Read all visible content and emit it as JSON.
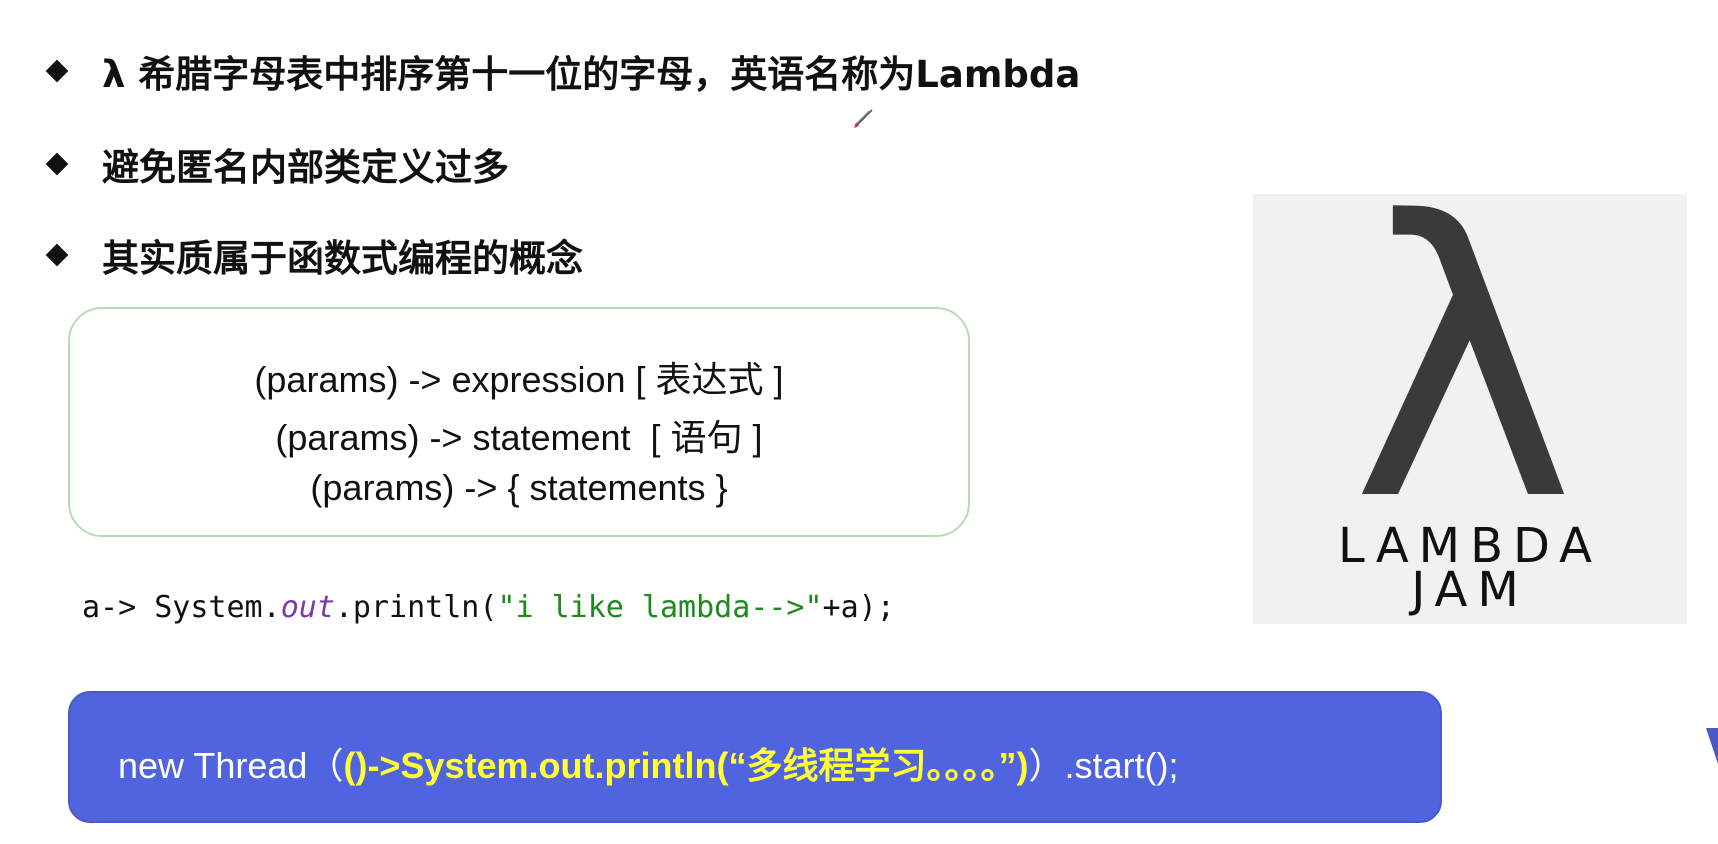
{
  "bullets": [
    "λ 希腊字母表中排序第十一位的字母，英语名称为Lambda",
    "避免匿名内部类定义过多",
    "其实质属于函数式编程的概念"
  ],
  "syntax_forms": [
    "(params) -> expression [ 表达式 ]",
    "(params) -> statement  [ 语句 ]",
    "(params) -> { statements }"
  ],
  "code_example": {
    "prefix": "a-> System.",
    "out": "out",
    "call": ".println(",
    "string": "\"i like lambda-->\"",
    "suffix": "+a);"
  },
  "thread_example": {
    "prefix": "new Thread（",
    "highlight": "()->System.out.println(“多线程学习。。。。”)",
    "suffix": "）.start();"
  },
  "logo": {
    "symbol": "λ",
    "line1": "LAMBDA",
    "line2": "JAM"
  },
  "colors": {
    "box_border": "#b7dbb7",
    "thread_bg": "#5164e0",
    "highlight": "#ffff33"
  }
}
